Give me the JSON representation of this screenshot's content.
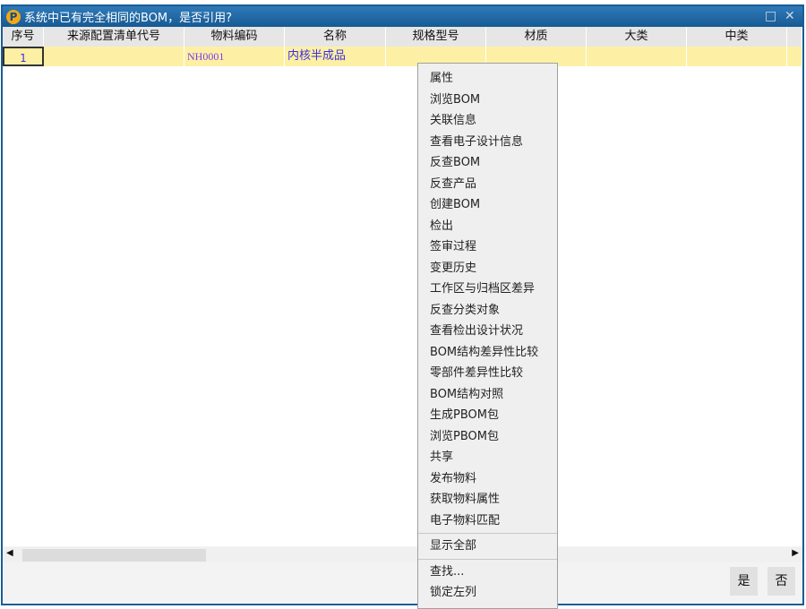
{
  "title": "系统中已有完全相同的BOM，是否引用?",
  "columns": [
    "序号",
    "来源配置清单代号",
    "物料编码",
    "名称",
    "规格型号",
    "材质",
    "大类",
    "中类"
  ],
  "row": {
    "seq": "1",
    "source": "",
    "code": "NH0001",
    "name": "内核半成品"
  },
  "menu": {
    "group1": [
      "属性",
      "浏览BOM",
      "关联信息",
      "查看电子设计信息",
      "反查BOM",
      "反查产品",
      "创建BOM",
      "检出",
      "签审过程",
      "变更历史",
      "工作区与归档区差异",
      "反查分类对象",
      "查看检出设计状况",
      "BOM结构差异性比较",
      "零部件差异性比较",
      "BOM结构对照",
      "生成PBOM包",
      "浏览PBOM包",
      "共享",
      "发布物料",
      "获取物料属性",
      "电子物料匹配"
    ],
    "show_all": "显示全部",
    "find": "查找...",
    "lock_left": "锁定左列"
  },
  "buttons": {
    "yes": "是",
    "no": "否"
  }
}
